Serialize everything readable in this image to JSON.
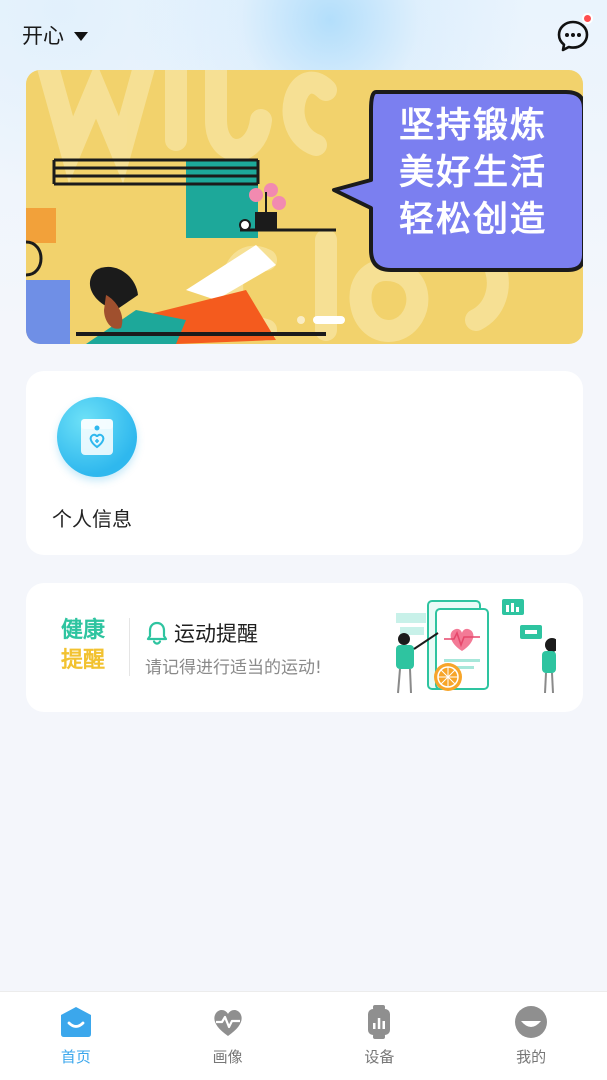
{
  "header": {
    "location": "开心"
  },
  "banner": {
    "lines": [
      "坚持锻炼",
      "美好生活",
      "轻松创造"
    ],
    "page_count": 2,
    "active_page": 2
  },
  "info_card": {
    "label": "个人信息"
  },
  "health_card": {
    "tag_line1": "健康",
    "tag_line2": "提醒",
    "title": "运动提醒",
    "subtitle": "请记得进行适当的运动!"
  },
  "nav": {
    "items": [
      {
        "label": "首页",
        "icon": "home-icon",
        "active": true
      },
      {
        "label": "画像",
        "icon": "heart-pulse-icon",
        "active": false
      },
      {
        "label": "设备",
        "icon": "watch-icon",
        "active": false
      },
      {
        "label": "我的",
        "icon": "profile-icon",
        "active": false
      }
    ]
  },
  "colors": {
    "accent": "#3ba7ec",
    "badge": "#ff4d4f",
    "health_green": "#2ec4a0",
    "health_yellow": "#f2c230",
    "banner_bg": "#f2d26c",
    "bubble": "#7b7ff0"
  }
}
